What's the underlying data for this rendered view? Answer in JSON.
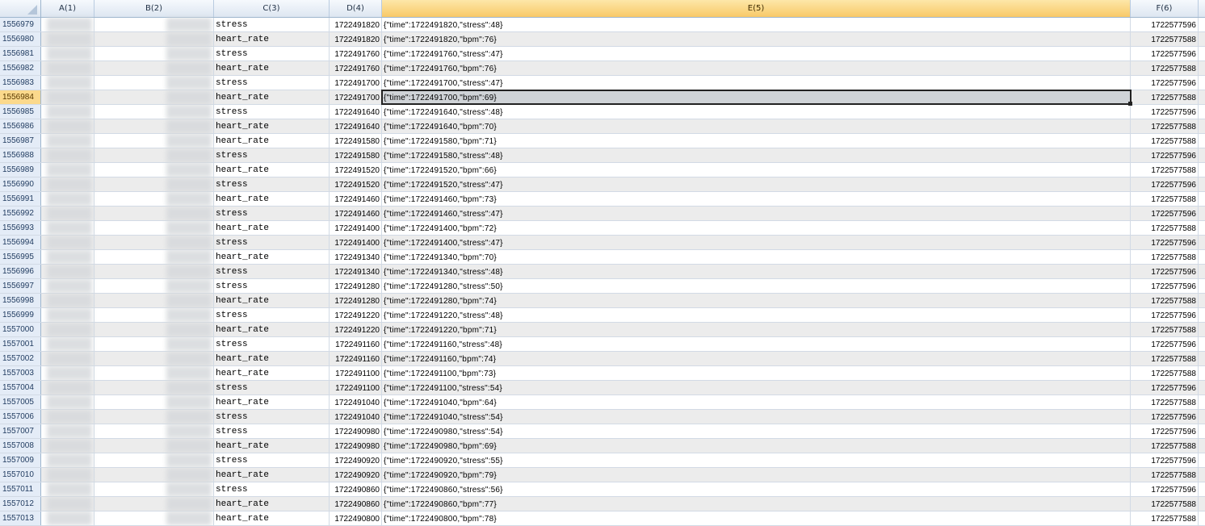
{
  "columns": [
    "A(1)",
    "B(2)",
    "C(3)",
    "D(4)",
    "E(5)",
    "F(6)"
  ],
  "selected_column_index": 4,
  "selected_row_number": "1556984",
  "rows": [
    {
      "n": "1556979",
      "c": "stress",
      "d": "1722491820",
      "e": "{\"time\":1722491820,\"stress\":48}",
      "f": "1722577596"
    },
    {
      "n": "1556980",
      "c": "heart_rate",
      "d": "1722491820",
      "e": "{\"time\":1722491820,\"bpm\":76}",
      "f": "1722577588"
    },
    {
      "n": "1556981",
      "c": "stress",
      "d": "1722491760",
      "e": "{\"time\":1722491760,\"stress\":47}",
      "f": "1722577596"
    },
    {
      "n": "1556982",
      "c": "heart_rate",
      "d": "1722491760",
      "e": "{\"time\":1722491760,\"bpm\":76}",
      "f": "1722577588"
    },
    {
      "n": "1556983",
      "c": "stress",
      "d": "1722491700",
      "e": "{\"time\":1722491700,\"stress\":47}",
      "f": "1722577596"
    },
    {
      "n": "1556984",
      "c": "heart_rate",
      "d": "1722491700",
      "e": "{\"time\":1722491700,\"bpm\":69}",
      "f": "1722577588"
    },
    {
      "n": "1556985",
      "c": "stress",
      "d": "1722491640",
      "e": "{\"time\":1722491640,\"stress\":48}",
      "f": "1722577596"
    },
    {
      "n": "1556986",
      "c": "heart_rate",
      "d": "1722491640",
      "e": "{\"time\":1722491640,\"bpm\":70}",
      "f": "1722577588"
    },
    {
      "n": "1556987",
      "c": "heart_rate",
      "d": "1722491580",
      "e": "{\"time\":1722491580,\"bpm\":71}",
      "f": "1722577588"
    },
    {
      "n": "1556988",
      "c": "stress",
      "d": "1722491580",
      "e": "{\"time\":1722491580,\"stress\":48}",
      "f": "1722577596"
    },
    {
      "n": "1556989",
      "c": "heart_rate",
      "d": "1722491520",
      "e": "{\"time\":1722491520,\"bpm\":66}",
      "f": "1722577588"
    },
    {
      "n": "1556990",
      "c": "stress",
      "d": "1722491520",
      "e": "{\"time\":1722491520,\"stress\":47}",
      "f": "1722577596"
    },
    {
      "n": "1556991",
      "c": "heart_rate",
      "d": "1722491460",
      "e": "{\"time\":1722491460,\"bpm\":73}",
      "f": "1722577588"
    },
    {
      "n": "1556992",
      "c": "stress",
      "d": "1722491460",
      "e": "{\"time\":1722491460,\"stress\":47}",
      "f": "1722577596"
    },
    {
      "n": "1556993",
      "c": "heart_rate",
      "d": "1722491400",
      "e": "{\"time\":1722491400,\"bpm\":72}",
      "f": "1722577588"
    },
    {
      "n": "1556994",
      "c": "stress",
      "d": "1722491400",
      "e": "{\"time\":1722491400,\"stress\":47}",
      "f": "1722577596"
    },
    {
      "n": "1556995",
      "c": "heart_rate",
      "d": "1722491340",
      "e": "{\"time\":1722491340,\"bpm\":70}",
      "f": "1722577588"
    },
    {
      "n": "1556996",
      "c": "stress",
      "d": "1722491340",
      "e": "{\"time\":1722491340,\"stress\":48}",
      "f": "1722577596"
    },
    {
      "n": "1556997",
      "c": "stress",
      "d": "1722491280",
      "e": "{\"time\":1722491280,\"stress\":50}",
      "f": "1722577596"
    },
    {
      "n": "1556998",
      "c": "heart_rate",
      "d": "1722491280",
      "e": "{\"time\":1722491280,\"bpm\":74}",
      "f": "1722577588"
    },
    {
      "n": "1556999",
      "c": "stress",
      "d": "1722491220",
      "e": "{\"time\":1722491220,\"stress\":48}",
      "f": "1722577596"
    },
    {
      "n": "1557000",
      "c": "heart_rate",
      "d": "1722491220",
      "e": "{\"time\":1722491220,\"bpm\":71}",
      "f": "1722577588"
    },
    {
      "n": "1557001",
      "c": "stress",
      "d": "1722491160",
      "e": "{\"time\":1722491160,\"stress\":48}",
      "f": "1722577596"
    },
    {
      "n": "1557002",
      "c": "heart_rate",
      "d": "1722491160",
      "e": "{\"time\":1722491160,\"bpm\":74}",
      "f": "1722577588"
    },
    {
      "n": "1557003",
      "c": "heart_rate",
      "d": "1722491100",
      "e": "{\"time\":1722491100,\"bpm\":73}",
      "f": "1722577588"
    },
    {
      "n": "1557004",
      "c": "stress",
      "d": "1722491100",
      "e": "{\"time\":1722491100,\"stress\":54}",
      "f": "1722577596"
    },
    {
      "n": "1557005",
      "c": "heart_rate",
      "d": "1722491040",
      "e": "{\"time\":1722491040,\"bpm\":64}",
      "f": "1722577588"
    },
    {
      "n": "1557006",
      "c": "stress",
      "d": "1722491040",
      "e": "{\"time\":1722491040,\"stress\":54}",
      "f": "1722577596"
    },
    {
      "n": "1557007",
      "c": "stress",
      "d": "1722490980",
      "e": "{\"time\":1722490980,\"stress\":54}",
      "f": "1722577596"
    },
    {
      "n": "1557008",
      "c": "heart_rate",
      "d": "1722490980",
      "e": "{\"time\":1722490980,\"bpm\":69}",
      "f": "1722577588"
    },
    {
      "n": "1557009",
      "c": "stress",
      "d": "1722490920",
      "e": "{\"time\":1722490920,\"stress\":55}",
      "f": "1722577596"
    },
    {
      "n": "1557010",
      "c": "heart_rate",
      "d": "1722490920",
      "e": "{\"time\":1722490920,\"bpm\":79}",
      "f": "1722577588"
    },
    {
      "n": "1557011",
      "c": "stress",
      "d": "1722490860",
      "e": "{\"time\":1722490860,\"stress\":56}",
      "f": "1722577596"
    },
    {
      "n": "1557012",
      "c": "heart_rate",
      "d": "1722490860",
      "e": "{\"time\":1722490860,\"bpm\":77}",
      "f": "1722577588"
    },
    {
      "n": "1557013",
      "c": "heart_rate",
      "d": "1722490800",
      "e": "{\"time\":1722490800,\"bpm\":78}",
      "f": "1722577588"
    }
  ]
}
